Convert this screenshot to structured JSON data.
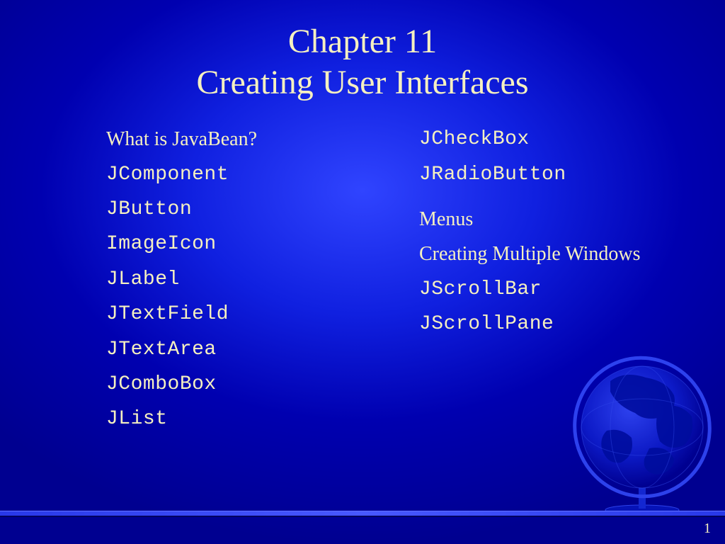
{
  "title": {
    "line1": "Chapter 11",
    "line2": "Creating User Interfaces"
  },
  "left_column": [
    {
      "text": "What is JavaBean?",
      "style": "serif"
    },
    {
      "text": "JComponent",
      "style": "mono"
    },
    {
      "text": "JButton",
      "style": "mono"
    },
    {
      "text": "ImageIcon",
      "style": "mono"
    },
    {
      "text": "JLabel",
      "style": "mono"
    },
    {
      "text": "JTextField",
      "style": "mono"
    },
    {
      "text": "JTextArea",
      "style": "mono"
    },
    {
      "text": "JComboBox",
      "style": "mono"
    },
    {
      "text": "JList",
      "style": "mono"
    }
  ],
  "right_column_a": [
    {
      "text": "JCheckBox",
      "style": "mono"
    },
    {
      "text": "JRadioButton",
      "style": "mono"
    }
  ],
  "right_column_b": [
    {
      "text": "Menus",
      "style": "serif"
    },
    {
      "text": "Creating Multiple Windows",
      "style": "serif"
    },
    {
      "text": "JScrollBar",
      "style": "mono"
    },
    {
      "text": "JScrollPane",
      "style": "mono"
    }
  ],
  "page_number": "1"
}
